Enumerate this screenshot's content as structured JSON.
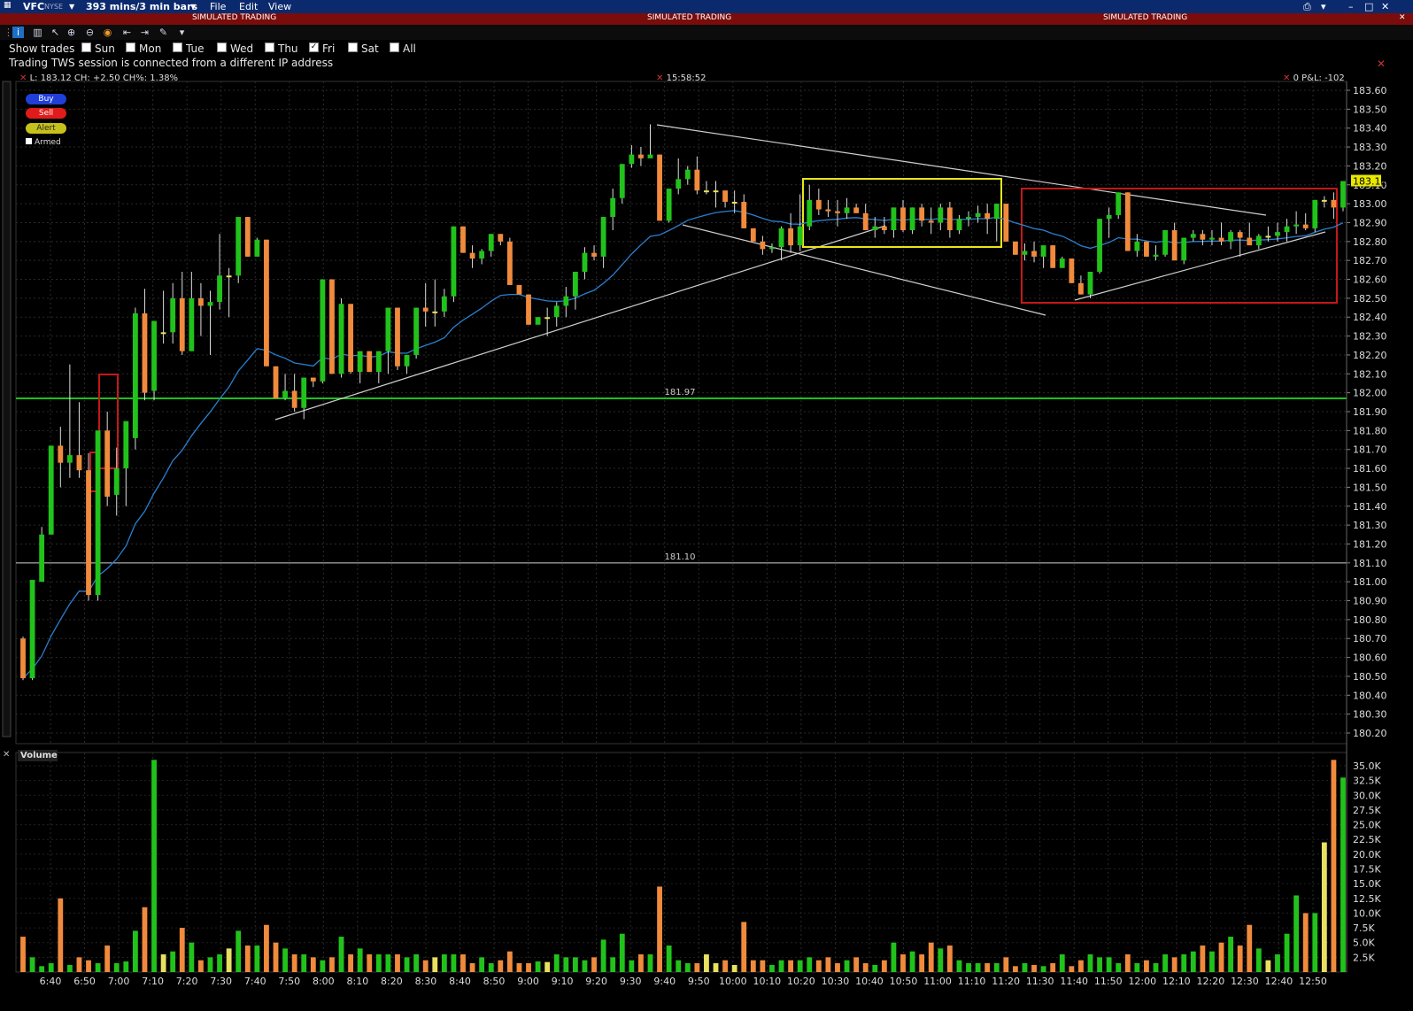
{
  "window": {
    "symbol": "VFC",
    "exchange": "NYSE",
    "bars_selector": "393 mins/3 min bars",
    "menu": [
      "File",
      "Edit",
      "View"
    ]
  },
  "banner": "SIMULATED TRADING",
  "controls": {
    "show_trades_label": "Show trades",
    "days": [
      {
        "label": "Sun",
        "checked": false
      },
      {
        "label": "Mon",
        "checked": false
      },
      {
        "label": "Tue",
        "checked": false
      },
      {
        "label": "Wed",
        "checked": false
      },
      {
        "label": "Thu",
        "checked": false
      },
      {
        "label": "Fri",
        "checked": true
      },
      {
        "label": "Sat",
        "checked": false
      },
      {
        "label": "All",
        "checked": false
      }
    ],
    "notice": "Trading TWS session is connected from a different IP address"
  },
  "quote": "L: 183.12 CH: +2.50 CH%: 1.38%",
  "time_readout": "15:58:52",
  "pnl": "0 P&L: -102",
  "order_buttons": {
    "buy": "Buy",
    "sell": "Sell",
    "alert": "Alert",
    "armed": "Armed"
  },
  "volume_panel_label": "Volume",
  "colors": {
    "up": "#21c21b",
    "down": "#f08a3c",
    "neutral": "#e8e060",
    "ema": "#2a7fd0",
    "support": "#1fbf1f",
    "box_yellow": "#e6e61a",
    "box_red": "#c41818"
  },
  "chart_data": {
    "type": "candlestick",
    "price_axis": {
      "min": 180.2,
      "max": 183.6,
      "ticks": [
        "183.60",
        "183.50",
        "183.40",
        "183.30",
        "183.20",
        "183.10",
        "183.00",
        "182.90",
        "182.80",
        "182.70",
        "182.60",
        "182.50",
        "182.40",
        "182.30",
        "182.20",
        "182.10",
        "182.00",
        "181.90",
        "181.80",
        "181.70",
        "181.60",
        "181.50",
        "181.40",
        "181.30",
        "181.20",
        "181.10",
        "181.00",
        "180.90",
        "180.80",
        "180.70",
        "180.60",
        "180.50",
        "180.40",
        "180.30",
        "180.20"
      ]
    },
    "last_price_label": "183.12",
    "horizontal_lines": [
      {
        "label": "181.97",
        "value": 181.97
      },
      {
        "label": "181.10",
        "value": 181.1
      }
    ],
    "time_ticks": [
      "6:40",
      "6:50",
      "7:00",
      "7:10",
      "7:20",
      "7:30",
      "7:40",
      "7:50",
      "8:00",
      "8:10",
      "8:20",
      "8:30",
      "8:40",
      "8:50",
      "9:00",
      "9:10",
      "9:20",
      "9:30",
      "9:40",
      "9:50",
      "10:00",
      "10:10",
      "10:20",
      "10:30",
      "10:40",
      "10:50",
      "11:00",
      "11:10",
      "11:20",
      "11:30",
      "11:40",
      "11:50",
      "12:00",
      "12:10",
      "12:20",
      "12:30",
      "12:40",
      "12:50"
    ],
    "volume_axis": {
      "max": 35000,
      "ticks": [
        "35.0K",
        "32.5K",
        "30.0K",
        "27.5K",
        "25.0K",
        "22.5K",
        "20.0K",
        "17.5K",
        "15.0K",
        "12.5K",
        "10.0K",
        "7.5K",
        "5.0K",
        "2.5K"
      ]
    },
    "candles": [
      [
        180.7,
        180.71,
        180.48,
        180.49,
        6000
      ],
      [
        180.49,
        181.01,
        180.48,
        181.01,
        2500
      ],
      [
        181.0,
        181.29,
        181.0,
        181.25,
        1000
      ],
      [
        181.25,
        181.72,
        181.25,
        181.72,
        1500
      ],
      [
        181.72,
        181.82,
        181.5,
        181.63,
        12500
      ],
      [
        181.63,
        182.15,
        181.55,
        181.67,
        1200
      ],
      [
        181.67,
        181.95,
        181.55,
        181.59,
        2500
      ],
      [
        181.59,
        181.68,
        180.9,
        180.93,
        2000
      ],
      [
        180.93,
        181.8,
        180.9,
        181.8,
        1500
      ],
      [
        181.8,
        181.9,
        181.4,
        181.45,
        4500
      ],
      [
        181.46,
        181.71,
        181.35,
        181.6,
        1500
      ],
      [
        181.6,
        181.67,
        181.4,
        181.85,
        1800
      ],
      [
        181.76,
        182.45,
        181.7,
        182.42,
        7000
      ],
      [
        182.42,
        182.55,
        181.96,
        182.0,
        11000
      ],
      [
        182.01,
        182.38,
        181.96,
        182.38,
        36000
      ],
      [
        182.32,
        182.54,
        182.26,
        182.32,
        3000
      ],
      [
        182.32,
        182.58,
        182.26,
        182.5,
        3500
      ],
      [
        182.5,
        182.64,
        182.2,
        182.22,
        7500
      ],
      [
        182.22,
        182.64,
        182.22,
        182.5,
        5000
      ],
      [
        182.5,
        182.58,
        182.3,
        182.46,
        2000
      ],
      [
        182.46,
        182.54,
        182.2,
        182.48,
        2500
      ],
      [
        182.48,
        182.84,
        182.44,
        182.62,
        3000
      ],
      [
        182.62,
        182.66,
        182.4,
        182.62,
        4000
      ],
      [
        182.62,
        182.93,
        182.58,
        182.93,
        7000
      ],
      [
        182.93,
        182.93,
        182.72,
        182.72,
        4500
      ],
      [
        182.72,
        182.82,
        182.75,
        182.81,
        4500
      ],
      [
        182.81,
        182.81,
        182.14,
        182.14,
        8000
      ],
      [
        182.14,
        182.14,
        181.97,
        181.97,
        5000
      ],
      [
        181.97,
        182.1,
        181.96,
        182.01,
        4000
      ],
      [
        182.01,
        182.1,
        181.9,
        181.92,
        3000
      ],
      [
        181.92,
        182.08,
        181.86,
        182.08,
        3000
      ],
      [
        182.08,
        182.08,
        182.03,
        182.06,
        2500
      ],
      [
        182.06,
        182.6,
        182.05,
        182.6,
        2000
      ],
      [
        182.6,
        182.55,
        182.1,
        182.1,
        2500
      ],
      [
        182.1,
        182.5,
        182.08,
        182.47,
        6000
      ],
      [
        182.47,
        182.47,
        182.1,
        182.11,
        3000
      ],
      [
        182.11,
        182.22,
        182.05,
        182.22,
        4000
      ],
      [
        182.22,
        182.22,
        182.11,
        182.11,
        3000
      ],
      [
        182.11,
        182.22,
        182.05,
        182.22,
        3000
      ],
      [
        182.22,
        182.45,
        182.1,
        182.45,
        3000
      ],
      [
        182.45,
        182.45,
        182.12,
        182.14,
        3000
      ],
      [
        182.14,
        182.2,
        182.1,
        182.2,
        2500
      ],
      [
        182.2,
        182.45,
        182.18,
        182.45,
        3000
      ],
      [
        182.45,
        182.58,
        182.35,
        182.43,
        2000
      ],
      [
        182.43,
        182.6,
        182.35,
        182.43,
        2500
      ],
      [
        182.43,
        182.55,
        182.4,
        182.51,
        3000
      ],
      [
        182.51,
        182.88,
        182.48,
        182.88,
        3000
      ],
      [
        182.88,
        182.88,
        182.74,
        182.74,
        3000
      ],
      [
        182.74,
        182.78,
        182.66,
        182.71,
        1500
      ],
      [
        182.71,
        182.76,
        182.68,
        182.75,
        2500
      ],
      [
        182.75,
        182.84,
        182.72,
        182.84,
        1500
      ],
      [
        182.84,
        182.84,
        182.78,
        182.8,
        2000
      ],
      [
        182.8,
        182.82,
        182.57,
        182.57,
        3500
      ],
      [
        182.57,
        182.57,
        182.52,
        182.52,
        1500
      ],
      [
        182.52,
        182.52,
        182.36,
        182.36,
        1500
      ],
      [
        182.36,
        182.4,
        182.37,
        182.4,
        1800
      ],
      [
        182.4,
        182.45,
        182.3,
        182.4,
        1700
      ],
      [
        182.4,
        182.48,
        182.35,
        182.46,
        3000
      ],
      [
        182.46,
        182.56,
        182.4,
        182.51,
        2500
      ],
      [
        182.51,
        182.64,
        182.44,
        182.64,
        2500
      ],
      [
        182.64,
        182.77,
        182.6,
        182.74,
        2000
      ],
      [
        182.74,
        182.78,
        182.7,
        182.72,
        2500
      ],
      [
        182.72,
        182.93,
        182.66,
        182.93,
        5500
      ],
      [
        182.93,
        183.08,
        182.86,
        183.03,
        2500
      ],
      [
        183.03,
        183.21,
        183.0,
        183.21,
        6500
      ],
      [
        183.21,
        183.31,
        183.19,
        183.26,
        2000
      ],
      [
        183.26,
        183.3,
        183.2,
        183.24,
        3000
      ],
      [
        183.24,
        183.42,
        183.25,
        183.26,
        3000
      ],
      [
        183.26,
        183.26,
        182.91,
        182.91,
        14500
      ],
      [
        182.91,
        183.08,
        182.9,
        183.08,
        4500
      ],
      [
        183.08,
        183.24,
        183.05,
        183.13,
        2000
      ],
      [
        183.13,
        183.2,
        183.1,
        183.18,
        1500
      ],
      [
        183.18,
        183.25,
        183.05,
        183.07,
        1500
      ],
      [
        183.07,
        183.12,
        183.05,
        183.07,
        3000
      ],
      [
        183.07,
        183.12,
        182.98,
        183.07,
        1500
      ],
      [
        183.07,
        183.07,
        182.98,
        183.01,
        2000
      ],
      [
        183.01,
        183.07,
        182.95,
        183.01,
        1200
      ],
      [
        183.01,
        183.05,
        182.87,
        182.87,
        8500
      ],
      [
        182.87,
        182.87,
        182.8,
        182.8,
        2000
      ],
      [
        182.8,
        182.83,
        182.73,
        182.76,
        2000
      ],
      [
        182.76,
        182.79,
        182.74,
        182.77,
        1200
      ],
      [
        182.77,
        182.88,
        182.7,
        182.87,
        2000
      ],
      [
        182.87,
        182.95,
        182.74,
        182.78,
        2000
      ],
      [
        182.78,
        183.05,
        182.75,
        182.88,
        2000
      ],
      [
        182.88,
        183.1,
        182.86,
        183.02,
        2500
      ],
      [
        183.02,
        183.08,
        182.94,
        182.97,
        2000
      ],
      [
        182.97,
        183.02,
        182.93,
        182.96,
        2500
      ],
      [
        182.96,
        183.02,
        182.88,
        182.95,
        1500
      ],
      [
        182.95,
        183.03,
        182.92,
        182.98,
        2000
      ],
      [
        182.98,
        183.0,
        182.95,
        182.95,
        2500
      ],
      [
        182.95,
        183.0,
        182.86,
        182.86,
        1500
      ],
      [
        182.86,
        182.93,
        182.82,
        182.88,
        1200
      ],
      [
        182.88,
        182.93,
        182.84,
        182.86,
        2000
      ],
      [
        182.86,
        182.98,
        182.82,
        182.98,
        5000
      ],
      [
        182.98,
        183.02,
        182.85,
        182.86,
        3000
      ],
      [
        182.86,
        182.98,
        182.84,
        182.98,
        3500
      ],
      [
        182.98,
        183.0,
        182.88,
        182.91,
        3000
      ],
      [
        182.91,
        182.98,
        182.84,
        182.9,
        5000
      ],
      [
        182.9,
        183.0,
        182.86,
        182.98,
        4000
      ],
      [
        182.98,
        183.01,
        182.82,
        182.86,
        4500
      ],
      [
        182.86,
        182.94,
        182.84,
        182.92,
        2000
      ],
      [
        182.92,
        182.96,
        182.88,
        182.93,
        1500
      ],
      [
        182.93,
        182.99,
        182.9,
        182.95,
        1500
      ],
      [
        182.95,
        183.0,
        182.84,
        182.92,
        1500
      ],
      [
        182.92,
        183.0,
        182.8,
        183.0,
        1500
      ],
      [
        183.0,
        183.0,
        182.8,
        182.8,
        2500
      ],
      [
        182.8,
        182.8,
        182.73,
        182.73,
        1000
      ],
      [
        182.73,
        182.79,
        182.7,
        182.75,
        1500
      ],
      [
        182.75,
        182.8,
        182.69,
        182.72,
        1200
      ],
      [
        182.72,
        182.75,
        182.66,
        182.78,
        1000
      ],
      [
        182.78,
        182.78,
        182.66,
        182.66,
        1500
      ],
      [
        182.66,
        182.72,
        182.68,
        182.71,
        3000
      ],
      [
        182.71,
        182.71,
        182.58,
        182.58,
        1000
      ],
      [
        182.58,
        182.62,
        182.52,
        182.52,
        2000
      ],
      [
        182.52,
        182.64,
        182.5,
        182.64,
        3000
      ],
      [
        182.64,
        182.92,
        182.63,
        182.92,
        2500
      ],
      [
        182.92,
        182.98,
        182.82,
        182.94,
        2500
      ],
      [
        182.94,
        183.06,
        182.92,
        183.06,
        1500
      ],
      [
        183.06,
        183.06,
        182.75,
        182.75,
        3000
      ],
      [
        182.75,
        182.84,
        182.72,
        182.8,
        1500
      ],
      [
        182.8,
        182.8,
        182.72,
        182.72,
        2000
      ],
      [
        182.72,
        182.78,
        182.7,
        182.73,
        1500
      ],
      [
        182.73,
        182.86,
        182.72,
        182.86,
        3000
      ],
      [
        182.86,
        182.9,
        182.7,
        182.7,
        2500
      ],
      [
        182.7,
        182.82,
        182.68,
        182.82,
        3000
      ],
      [
        182.82,
        182.86,
        182.8,
        182.84,
        3500
      ],
      [
        182.84,
        182.86,
        182.78,
        182.81,
        4500
      ],
      [
        182.81,
        182.86,
        182.78,
        182.82,
        3500
      ],
      [
        182.82,
        182.9,
        182.78,
        182.8,
        5000
      ],
      [
        182.8,
        182.86,
        182.76,
        182.85,
        6000
      ],
      [
        182.85,
        182.86,
        182.72,
        182.82,
        4500
      ],
      [
        182.82,
        182.9,
        182.8,
        182.78,
        8000
      ],
      [
        182.78,
        182.84,
        182.76,
        182.83,
        4000
      ],
      [
        182.83,
        182.88,
        182.8,
        182.83,
        2000
      ],
      [
        182.83,
        182.9,
        182.8,
        182.85,
        3000
      ],
      [
        182.85,
        182.92,
        182.8,
        182.88,
        6500
      ],
      [
        182.88,
        182.96,
        182.84,
        182.89,
        13000
      ],
      [
        182.89,
        182.95,
        182.86,
        182.87,
        10000
      ],
      [
        182.87,
        183.02,
        182.85,
        183.02,
        10000
      ],
      [
        183.02,
        183.04,
        182.98,
        183.02,
        22000
      ],
      [
        183.02,
        183.06,
        182.92,
        182.98,
        36000
      ],
      [
        182.98,
        183.12,
        182.96,
        183.12,
        33000
      ]
    ]
  }
}
